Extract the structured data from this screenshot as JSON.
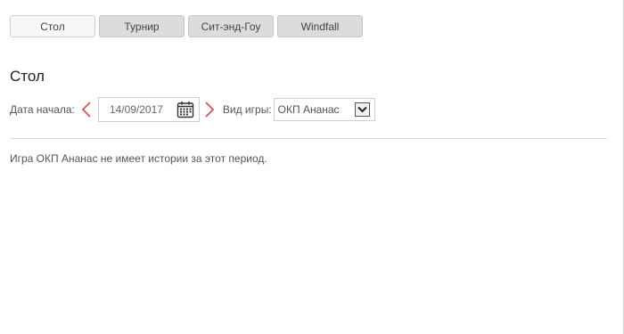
{
  "tabs": [
    {
      "label": "Стол",
      "active": true
    },
    {
      "label": "Турнир",
      "active": false
    },
    {
      "label": "Сит-энд-Гоу",
      "active": false
    },
    {
      "label": "Windfall",
      "active": false
    }
  ],
  "section_title": "Стол",
  "filters": {
    "start_date_label": "Дата начала:",
    "start_date_value": "14/09/2017",
    "game_type_label": "Вид игры:",
    "game_type_value": "ОКП Ананас"
  },
  "message": "Игра ОКП Ананас не имеет истории за этот период.",
  "colors": {
    "arrow_red": "#d9534f"
  },
  "icons": {
    "prev": "chevron-left-icon",
    "next": "chevron-right-icon",
    "calendar": "calendar-icon",
    "dropdown": "chevron-down-icon"
  }
}
